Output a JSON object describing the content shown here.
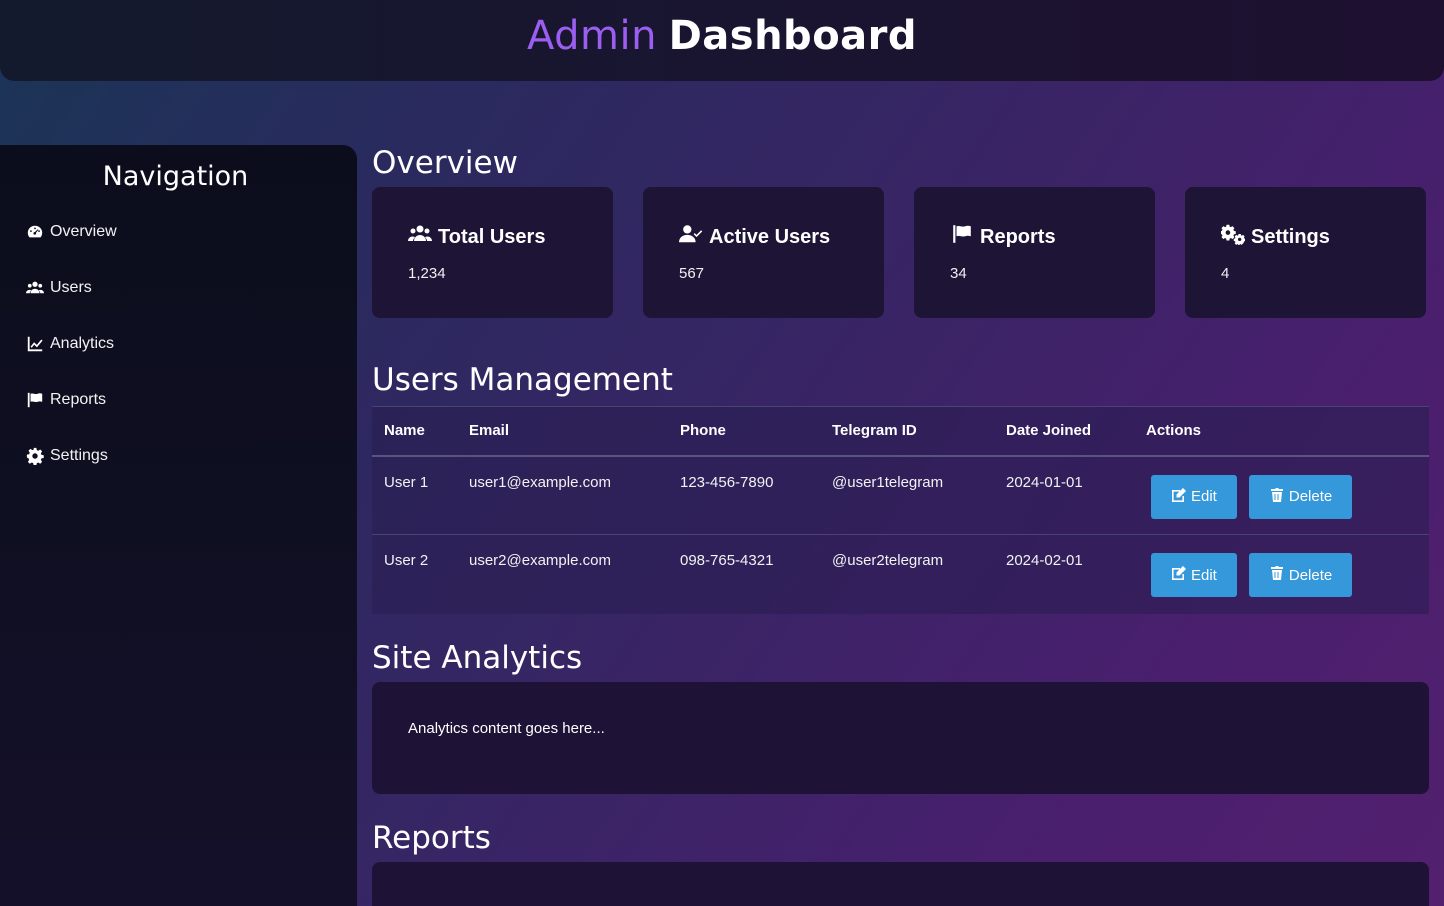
{
  "header": {
    "title_accent": "Admin",
    "title_rest": "Dashboard"
  },
  "sidebar": {
    "title": "Navigation",
    "items": [
      {
        "label": "Overview",
        "icon": "dashboard-icon"
      },
      {
        "label": "Users",
        "icon": "users-icon"
      },
      {
        "label": "Analytics",
        "icon": "chart-line-icon"
      },
      {
        "label": "Reports",
        "icon": "flag-icon"
      },
      {
        "label": "Settings",
        "icon": "gear-icon"
      }
    ]
  },
  "overview": {
    "title": "Overview",
    "cards": [
      {
        "title": "Total Users",
        "value": "1,234",
        "icon": "users-icon"
      },
      {
        "title": "Active Users",
        "value": "567",
        "icon": "user-check-icon"
      },
      {
        "title": "Reports",
        "value": "34",
        "icon": "flag-icon"
      },
      {
        "title": "Settings",
        "value": "4",
        "icon": "gears-icon"
      }
    ]
  },
  "users": {
    "title": "Users Management",
    "columns": [
      "Name",
      "Email",
      "Phone",
      "Telegram ID",
      "Date Joined",
      "Actions"
    ],
    "rows": [
      {
        "name": "User 1",
        "email": "user1@example.com",
        "phone": "123-456-7890",
        "telegram": "@user1telegram",
        "joined": "2024-01-01"
      },
      {
        "name": "User 2",
        "email": "user2@example.com",
        "phone": "098-765-4321",
        "telegram": "@user2telegram",
        "joined": "2024-02-01"
      }
    ],
    "edit_label": "Edit",
    "delete_label": "Delete"
  },
  "analytics": {
    "title": "Site Analytics",
    "content": "Analytics content goes here..."
  },
  "reports": {
    "title": "Reports"
  },
  "colors": {
    "accent": "#9b5ef0",
    "button": "#3498db",
    "card": "#1e1436"
  }
}
